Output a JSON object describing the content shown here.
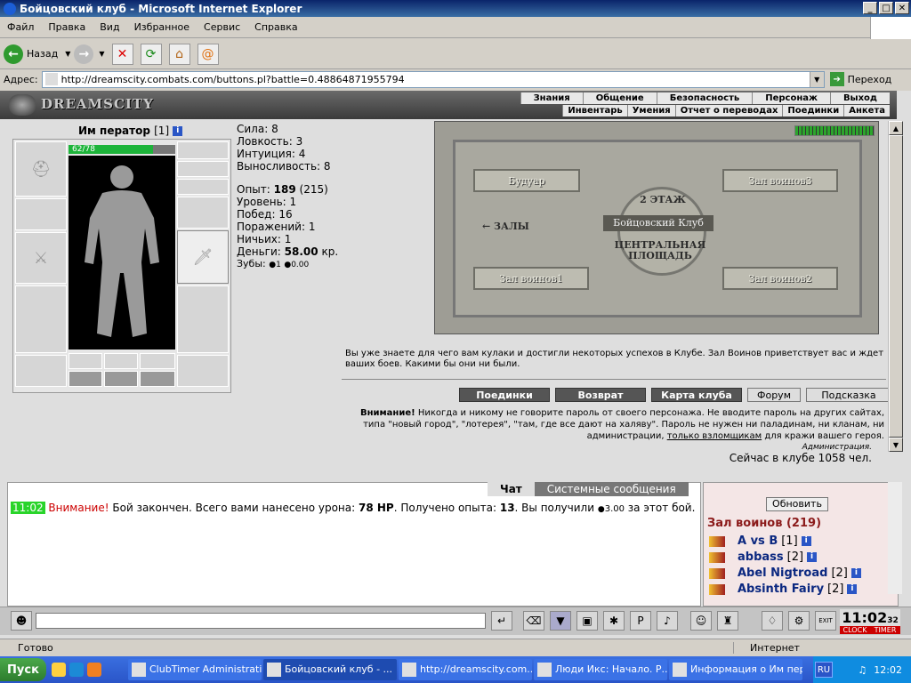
{
  "window": {
    "title": "Бойцовский клуб - Microsoft Internet Explorer"
  },
  "menubar": [
    "Файл",
    "Правка",
    "Вид",
    "Избранное",
    "Сервис",
    "Справка"
  ],
  "toolbar": {
    "back_label": "Назад"
  },
  "address": {
    "label": "Адрес:",
    "url": "http://dreamscity.combats.com/buttons.pl?battle=0.48864871955794",
    "go_label": "Переход"
  },
  "game": {
    "logo": "DREAMSCITY",
    "nav_top": [
      "Знания",
      "Общение",
      "Безопасность",
      "Персонаж",
      "Выход"
    ],
    "nav_bottom": [
      "Инвентарь",
      "Умения",
      "Отчет о переводах",
      "Поединки",
      "Анкета"
    ]
  },
  "character": {
    "name": "Им ператор",
    "level": "[1]",
    "hp": "62/78",
    "hp_ratio": 0.79,
    "stats": [
      {
        "label": "Сила:",
        "value": "8"
      },
      {
        "label": "Ловкость:",
        "value": "3"
      },
      {
        "label": "Интуиция:",
        "value": "4"
      },
      {
        "label": "Выносливость:",
        "value": "8"
      }
    ],
    "exp_label": "Опыт:",
    "exp_value": "189",
    "exp_next": "(215)",
    "level_label": "Уровень:",
    "level_value": "1",
    "wins_label": "Побед:",
    "wins_value": "16",
    "losses_label": "Поражений:",
    "losses_value": "1",
    "draws_label": "Ничьих:",
    "draws_value": "1",
    "money_label": "Деньги:",
    "money_value": "58.00",
    "money_unit": "кр.",
    "teeth_label": "Зубы:",
    "teeth_value1": "1",
    "teeth_value2": "0.00"
  },
  "map": {
    "floor": "2 ЭТАЖ",
    "rooms": {
      "boudoir": "Будуар",
      "hall3": "Зал воинов3",
      "halls": "ЗАЛЫ",
      "club": "Бойцовский Клуб",
      "central": "ЦЕНТРАЛЬНАЯ ПЛОЩАДЬ",
      "hall1": "Зал воинов1",
      "hall2": "Зал воинов2"
    }
  },
  "welcome_text": "Вы уже знаете для чего вам кулаки и достигли некоторых успехов в Клубе. Зал Воинов приветствует вас и ждет ваших боев. Какими бы они ни были.",
  "buttons": [
    "Поединки",
    "Возврат",
    "Карта клуба",
    "Форум",
    "Подсказка"
  ],
  "warning": {
    "title": "Внимание!",
    "text": "Никогда и никому не говорите пароль от своего персонажа. Не вводите пароль на других сайтах, типа \"новый город\", \"лотерея\", \"там, где все дают на халяву\". Пароль не нужен ни паладинам, ни кланам, ни администрации,",
    "link": "только взломщикам",
    "tail": "для кражи вашего героя.",
    "signature": "Администрация."
  },
  "online": "Сейчас в клубе 1058 чел.",
  "chat": {
    "tabs": [
      "Чат",
      "Системные сообщения"
    ],
    "time": "11:02",
    "attention": "Внимание!",
    "msg1": "Бой закончен. Всего вами нанесено урона:",
    "damage": "78 HP",
    "msg2": ". Получено опыта:",
    "exp": "13",
    "msg3": ". Вы получили",
    "reward": "3.00",
    "msg4": "за этот бой."
  },
  "room": {
    "refresh_label": "Обновить",
    "title": "Зал воинов (219)",
    "users": [
      {
        "name": "A vs B",
        "level": "[1]"
      },
      {
        "name": "abbass",
        "level": "[2]"
      },
      {
        "name": "Abel Nigtroad",
        "level": "[2]"
      },
      {
        "name": "Absinth Fairy",
        "level": "[2]"
      }
    ]
  },
  "clock": {
    "time": "11:02",
    "sec": "32",
    "labels": [
      "CLOCK",
      "TIMER"
    ],
    "exit": "EXIT"
  },
  "status": {
    "text": "Готово",
    "zone": "Интернет"
  },
  "taskbar": {
    "start": "Пуск",
    "tasks": [
      "ClubTimer Administration",
      "Бойцовский клуб - ...",
      "http://dreamscity.com....",
      "Люди Икс: Начало. Р...",
      "Информация о Им пер..."
    ],
    "lang": "RU",
    "time": "12:02"
  }
}
